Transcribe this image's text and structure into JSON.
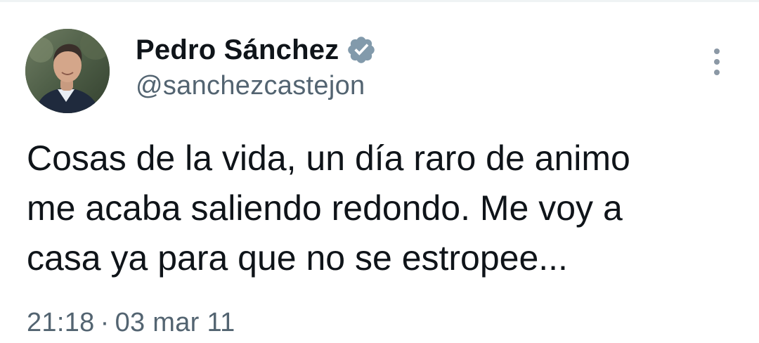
{
  "author": {
    "display_name": "Pedro Sánchez",
    "handle": "@sanchezcastejon",
    "verified": true,
    "verified_color": "#829aab"
  },
  "tweet": {
    "text_lines": [
      "Cosas de la vida, un día raro de animo",
      "me acaba saliendo redondo. Me voy a",
      "casa ya para que no se estropee..."
    ],
    "time": "21:18",
    "separator": "·",
    "date": "03 mar 11"
  },
  "icons": {
    "avatar": "profile-photo",
    "badge": "verified-check-icon",
    "menu": "more-vertical-icon"
  },
  "colors": {
    "text_primary": "#0f1419",
    "text_secondary": "#536471",
    "background": "#ffffff"
  }
}
